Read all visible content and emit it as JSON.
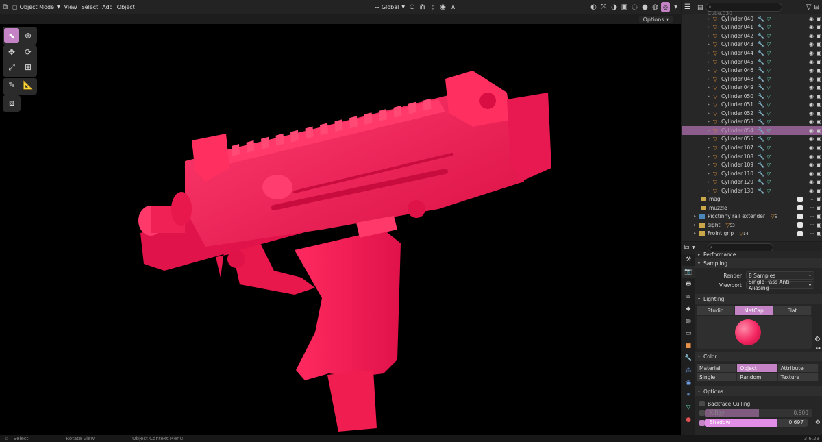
{
  "header": {
    "mode": "Object Mode",
    "menus": [
      "View",
      "Select",
      "Add",
      "Object"
    ],
    "orientation": "Global",
    "options": "Options"
  },
  "outliner": {
    "partial_top": "Cube.030",
    "rows": [
      {
        "name": "Cylinder.040",
        "selected": false
      },
      {
        "name": "Cylinder.041",
        "selected": false
      },
      {
        "name": "Cylinder.042",
        "selected": false
      },
      {
        "name": "Cylinder.043",
        "selected": false
      },
      {
        "name": "Cylinder.044",
        "selected": false
      },
      {
        "name": "Cylinder.045",
        "selected": false
      },
      {
        "name": "Cylinder.046",
        "selected": false
      },
      {
        "name": "Cylinder.048",
        "selected": false
      },
      {
        "name": "Cylinder.049",
        "selected": false
      },
      {
        "name": "Cylinder.050",
        "selected": false
      },
      {
        "name": "Cylinder.051",
        "selected": false
      },
      {
        "name": "Cylinder.052",
        "selected": false
      },
      {
        "name": "Cylinder.053",
        "selected": false
      },
      {
        "name": "Cylinder.054",
        "selected": true
      },
      {
        "name": "Cylinder.055",
        "selected": false
      },
      {
        "name": "Cylinder.107",
        "selected": false
      },
      {
        "name": "Cylinder.108",
        "selected": false
      },
      {
        "name": "Cylinder.109",
        "selected": false
      },
      {
        "name": "Cylinder.110",
        "selected": false
      },
      {
        "name": "Cylinder.129",
        "selected": false
      },
      {
        "name": "Cylinder.130",
        "selected": false
      }
    ],
    "collections": [
      {
        "name": "mag",
        "badge": ""
      },
      {
        "name": "muzzle",
        "badge": ""
      },
      {
        "name": "Picctinny rail extender",
        "badge": "5"
      },
      {
        "name": "sight",
        "badge": "53"
      },
      {
        "name": "Froint grip",
        "badge": "14"
      }
    ]
  },
  "properties": {
    "partial_top": "Performance",
    "sampling": {
      "title": "Sampling",
      "render_label": "Render",
      "render_value": "8 Samples",
      "viewport_label": "Viewport",
      "viewport_value": "Single Pass Anti-Aliasing"
    },
    "lighting": {
      "title": "Lighting",
      "options": [
        "Studio",
        "MatCap",
        "Flat"
      ],
      "active": "MatCap"
    },
    "color": {
      "title": "Color",
      "options": [
        "Material",
        "Object",
        "Attribute",
        "Single",
        "Random",
        "Texture"
      ],
      "active": "Object"
    },
    "options": {
      "title": "Options",
      "backface_culling": "Backface Culling",
      "xray_label": "X-Ray",
      "xray_value": "0.500",
      "shadow_label": "Shadow",
      "shadow_value": "0.697"
    }
  },
  "status": {
    "items": [
      "Select",
      "Rotate View",
      "Object Context Menu"
    ],
    "version": "3.6.23"
  },
  "colors": {
    "accent": "#c383c5",
    "model": "#ff1f57"
  }
}
